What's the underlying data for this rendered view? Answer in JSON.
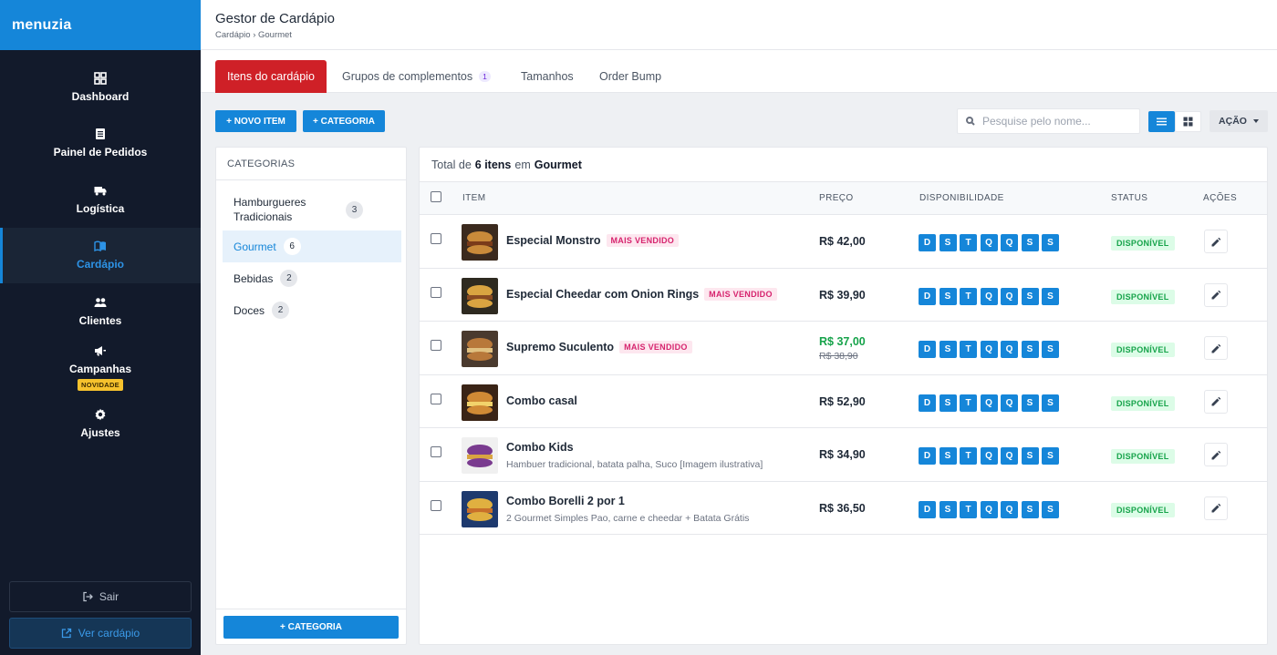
{
  "brand": {
    "name": "menuzia",
    "color": "#1586d9"
  },
  "sidebar": {
    "items": [
      {
        "label": "Dashboard",
        "icon": "dashboard-icon",
        "active": false
      },
      {
        "label": "Painel de Pedidos",
        "icon": "orders-icon",
        "active": false
      },
      {
        "label": "Logística",
        "icon": "truck-icon",
        "active": false
      },
      {
        "label": "Cardápio",
        "icon": "book-icon",
        "active": true
      },
      {
        "label": "Clientes",
        "icon": "users-icon",
        "active": false
      },
      {
        "label": "Campanhas",
        "icon": "megaphone-icon",
        "active": false,
        "badge": "NOVIDADE"
      },
      {
        "label": "Ajustes",
        "icon": "gear-icon",
        "active": false
      }
    ],
    "logout_label": "Sair",
    "view_menu_label": "Ver cardápio"
  },
  "header": {
    "title": "Gestor de Cardápio",
    "breadcrumb": "Cardápio › Gourmet"
  },
  "tabs": [
    {
      "label": "Itens do cardápio",
      "active": true
    },
    {
      "label": "Grupos de complementos",
      "count": "1"
    },
    {
      "label": "Tamanhos"
    },
    {
      "label": "Order Bump"
    }
  ],
  "toolbar": {
    "new_item_label": "+ NOVO ITEM",
    "category_label": "+ CATEGORIA",
    "search_placeholder": "Pesquise pelo nome...",
    "action_label": "AÇÃO"
  },
  "categories": {
    "heading": "CATEGORIAS",
    "items": [
      {
        "name": "Hamburgueres Tradicionais",
        "count": "3",
        "active": false
      },
      {
        "name": "Gourmet",
        "count": "6",
        "active": true
      },
      {
        "name": "Bebidas",
        "count": "2",
        "active": false
      },
      {
        "name": "Doces",
        "count": "2",
        "active": false
      }
    ],
    "add_label": "+ CATEGORIA"
  },
  "items_panel": {
    "total_prefix": "Total de",
    "total_count": "6 itens",
    "total_mid": "em",
    "total_category": "Gourmet",
    "columns": [
      "ITEM",
      "PREÇO",
      "DISPONIBILIDADE",
      "STATUS",
      "AÇÕES"
    ],
    "day_labels": [
      "D",
      "S",
      "T",
      "Q",
      "Q",
      "S",
      "S"
    ],
    "rows": [
      {
        "name": "Especial Monstro",
        "tag": "MAIS VENDIDO",
        "price": "R$ 42,00",
        "status": "DISPONÍVEL"
      },
      {
        "name": "Especial Cheedar com Onion Rings",
        "tag": "MAIS VENDIDO",
        "price": "R$ 39,90",
        "status": "DISPONÍVEL"
      },
      {
        "name": "Supremo Suculento",
        "tag": "MAIS VENDIDO",
        "price": "R$ 37,00",
        "old_price": "R$ 38,90",
        "status": "DISPONÍVEL"
      },
      {
        "name": "Combo casal",
        "price": "R$ 52,90",
        "status": "DISPONÍVEL"
      },
      {
        "name": "Combo Kids",
        "description": "Hambuer tradicional, batata palha, Suco [Imagem ilustrativa]",
        "price": "R$ 34,90",
        "status": "DISPONÍVEL"
      },
      {
        "name": "Combo Borelli 2 por 1",
        "description": "2 Gourmet Simples Pao, carne e cheedar + Batata Grátis",
        "price": "R$ 36,50",
        "status": "DISPONÍVEL"
      }
    ]
  }
}
